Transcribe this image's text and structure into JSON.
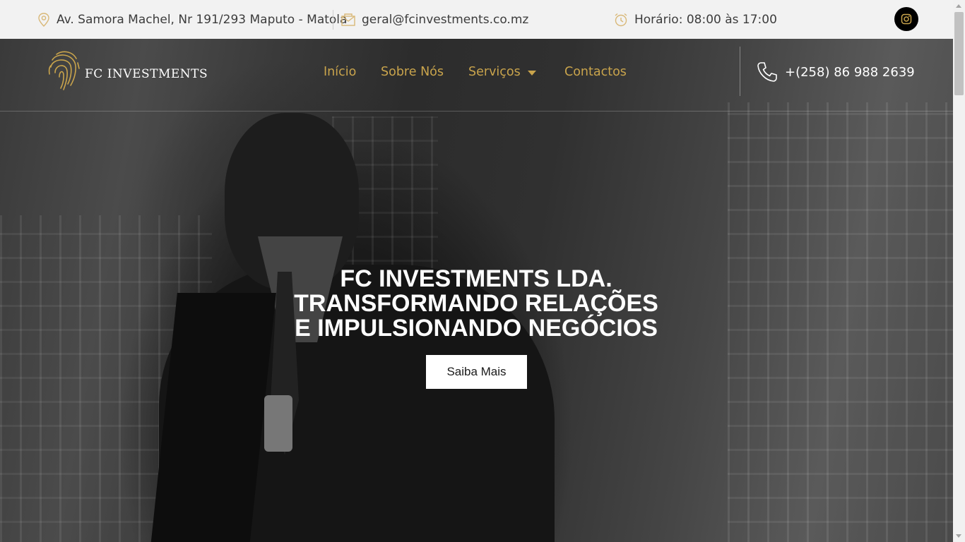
{
  "topbar": {
    "address": "Av. Samora Machel, Nr 191/293 Maputo - Matola",
    "email": "geral@fcinvestments.co.mz",
    "hours": "Horário: 08:00 às 17:00",
    "icons": [
      "location-icon",
      "mail-icon",
      "alarm-clock-icon",
      "instagram-icon"
    ]
  },
  "header": {
    "logo_text": "FC INVESTMENTS",
    "nav": {
      "inicio": "Início",
      "sobre": "Sobre Nós",
      "servicos": "Serviços",
      "contactos": "Contactos"
    },
    "phone": "+(258) 86 988 2639"
  },
  "hero": {
    "headline_1": "FC INVESTMENTS LDA.",
    "headline_2": "TRANSFORMANDO RELAÇÕES",
    "headline_3": "E IMPULSIONANDO NEGÓCIOS",
    "cta_label": "Saiba Mais"
  },
  "colors": {
    "accent_gold": "#c9a44c",
    "topbar_bg": "#f2f2f2",
    "text_dark": "#3c3c3c"
  }
}
